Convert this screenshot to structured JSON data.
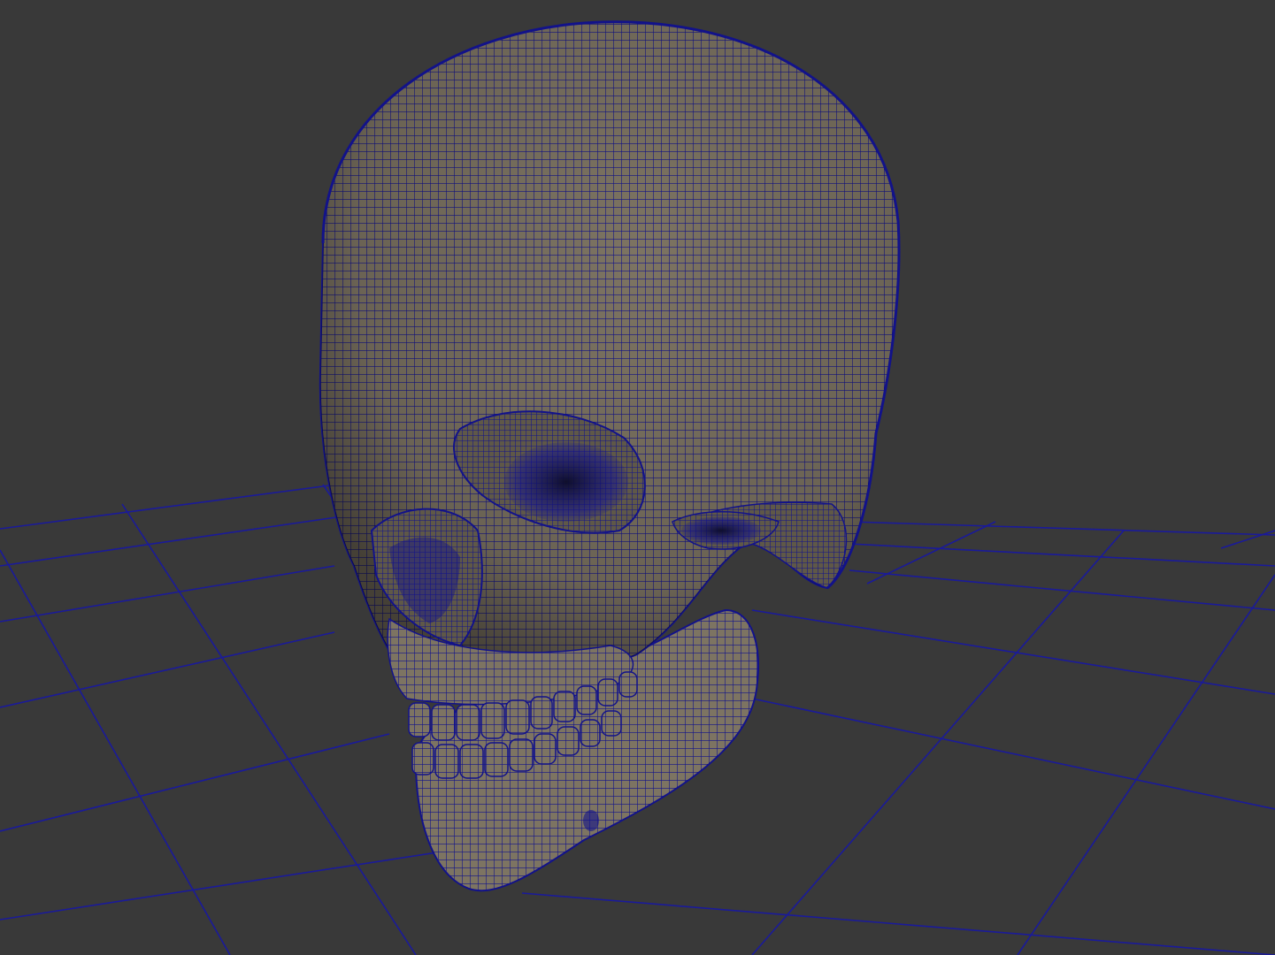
{
  "viewport": {
    "background_color": "#393939",
    "wireframe_color": "#12128a",
    "surface_color": "#7d7462",
    "shadow_color": "#3a3830",
    "show_ground_grid": true,
    "wireframe_on_shaded": true
  },
  "scene": {
    "object": "skull-mesh",
    "icons": {
      "model": "skull-icon",
      "grid": "ground-grid-icon"
    }
  }
}
